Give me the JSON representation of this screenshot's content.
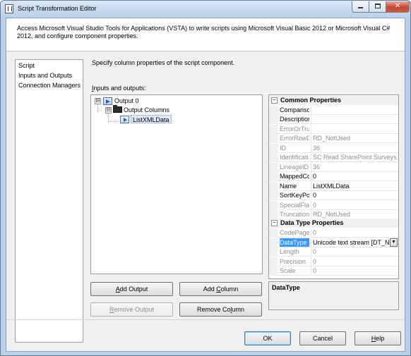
{
  "window": {
    "title": "Script Transformation Editor"
  },
  "header": {
    "description": "Access Microsoft Visual Studio Tools for Applications (VSTA) to write scripts using Microsoft Visual Basic 2012 or Microsoft Visual C# 2012, and configure component properties."
  },
  "nav": {
    "items": [
      {
        "label": "Script"
      },
      {
        "label": "Inputs and Outputs"
      },
      {
        "label": "Connection Managers"
      }
    ],
    "selected": "Inputs and Outputs"
  },
  "main": {
    "description": "Specify column properties of the script component.",
    "io_label_accel": "I",
    "io_label_rest": "nputs and outputs:"
  },
  "tree": {
    "output": {
      "label": "Output 0",
      "expander": "⊟"
    },
    "columns_folder": {
      "label": "Output Columns",
      "expander": "⊟"
    },
    "column": {
      "label": "ListXMLData"
    }
  },
  "buttons": {
    "add_output": {
      "accel": "A",
      "rest": "dd Output"
    },
    "add_column": {
      "pre": "Add ",
      "accel": "C",
      "rest": "olumn"
    },
    "remove_output": {
      "accel": "R",
      "rest": "emove Output"
    },
    "remove_column": {
      "pre": "Remove Co",
      "accel": "l",
      "rest": "umn"
    },
    "ok": "OK",
    "cancel": "Cancel",
    "help": {
      "accel": "H",
      "rest": "elp"
    }
  },
  "properties": {
    "common_header": "Common Properties",
    "common": [
      {
        "name": "Compariso",
        "value": "",
        "readonly": false
      },
      {
        "name": "Descriptior",
        "value": "",
        "readonly": false
      },
      {
        "name": "ErrorOrTru",
        "value": "",
        "readonly": true
      },
      {
        "name": "ErrorRowD",
        "value": "RD_NotUsed",
        "readonly": true
      },
      {
        "name": "ID",
        "value": "36",
        "readonly": true
      },
      {
        "name": "Identificati",
        "value": "SC Read SharePoint Surveys.Outp",
        "readonly": true
      },
      {
        "name": "LineageID",
        "value": "36",
        "readonly": true
      },
      {
        "name": "MappedCc",
        "value": "0",
        "readonly": false
      },
      {
        "name": "Name",
        "value": "ListXMLData",
        "readonly": false
      },
      {
        "name": "SortKeyPos",
        "value": "0",
        "readonly": false
      },
      {
        "name": "SpecialFlag",
        "value": "0",
        "readonly": true
      },
      {
        "name": "Truncation",
        "value": "RD_NotUsed",
        "readonly": true
      }
    ],
    "datatype_header": "Data Type Properties",
    "datatype": [
      {
        "name": "CodePage",
        "value": "0",
        "readonly": true
      },
      {
        "name": "DataType",
        "value": "Unicode text stream [DT_NTEXT]",
        "readonly": false,
        "selected": true
      },
      {
        "name": "Length",
        "value": "0",
        "readonly": true
      },
      {
        "name": "Precision",
        "value": "0",
        "readonly": true
      },
      {
        "name": "Scale",
        "value": "0",
        "readonly": true
      }
    ],
    "collapse_glyph": "−",
    "combo_glyph": "▼"
  },
  "description_pane": {
    "title": "DataType"
  },
  "colors": {
    "selection": "#3399ff",
    "window_frame": "#b9d1ea"
  }
}
